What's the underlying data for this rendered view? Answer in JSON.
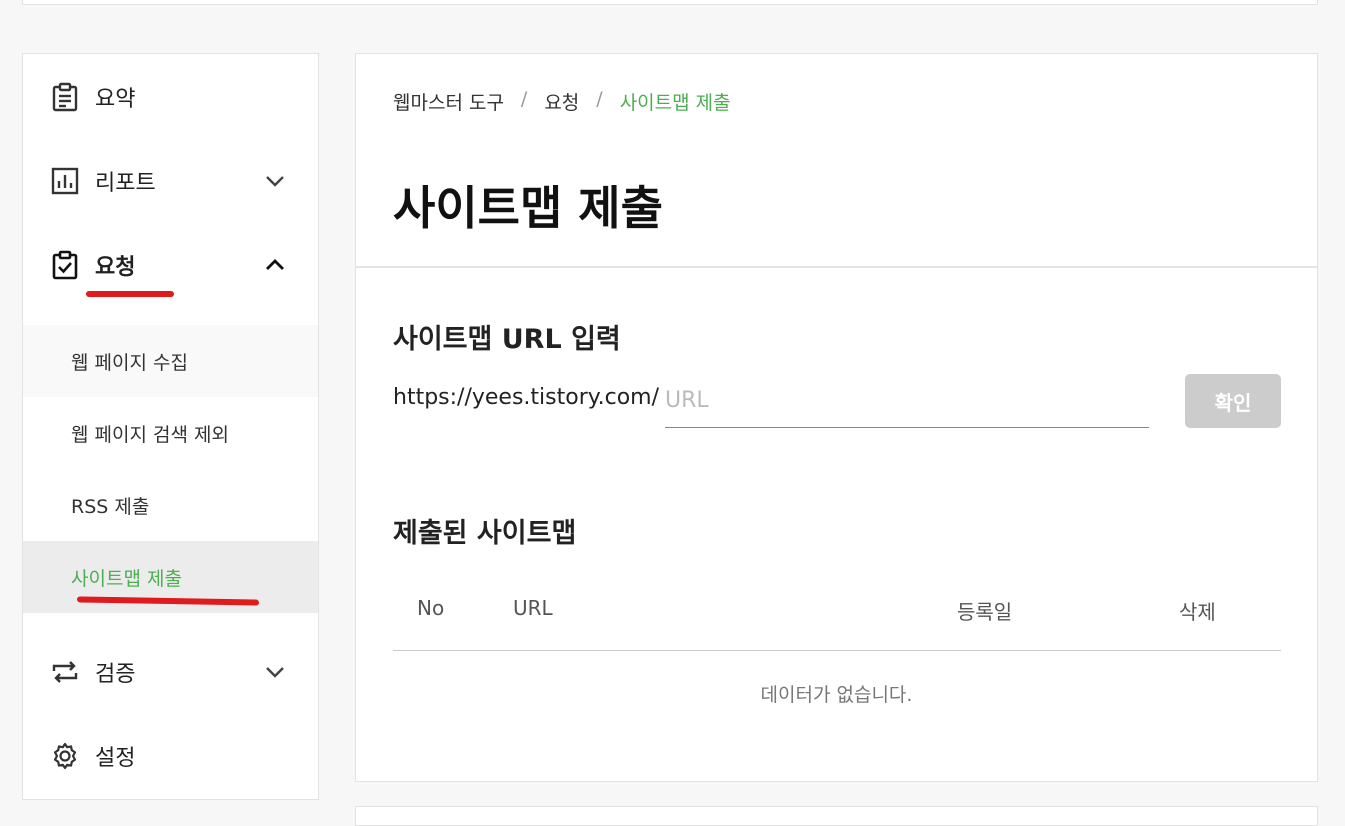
{
  "sidebar": {
    "items": [
      {
        "label": "요약",
        "icon": "clipboard-list-icon"
      },
      {
        "label": "리포트",
        "icon": "bar-chart-icon"
      },
      {
        "label": "요청",
        "icon": "clipboard-check-icon"
      },
      {
        "label": "검증",
        "icon": "repeat-arrows-icon"
      },
      {
        "label": "설정",
        "icon": "gear-icon"
      }
    ],
    "sub_items": [
      {
        "label": "웹 페이지 수집"
      },
      {
        "label": "웹 페이지 검색 제외"
      },
      {
        "label": "RSS 제출"
      },
      {
        "label": "사이트맵 제출"
      }
    ]
  },
  "breadcrumb": {
    "items": [
      "웹마스터 도구",
      "요청",
      "사이트맵 제출"
    ],
    "separator": "/"
  },
  "page_title": "사이트맵 제출",
  "sitemap_input": {
    "section_title": "사이트맵 URL 입력",
    "prefix": "https://yees.tistory.com/",
    "placeholder": "URL",
    "value": "",
    "confirm_label": "확인"
  },
  "submitted": {
    "section_title": "제출된 사이트맵",
    "columns": [
      "No",
      "URL",
      "등록일",
      "삭제"
    ],
    "rows": [],
    "empty_message": "데이터가 없습니다."
  },
  "colors": {
    "accent_green": "#4caf50",
    "annotation_red": "#e01b1b",
    "disabled_button": "#cccccc"
  }
}
